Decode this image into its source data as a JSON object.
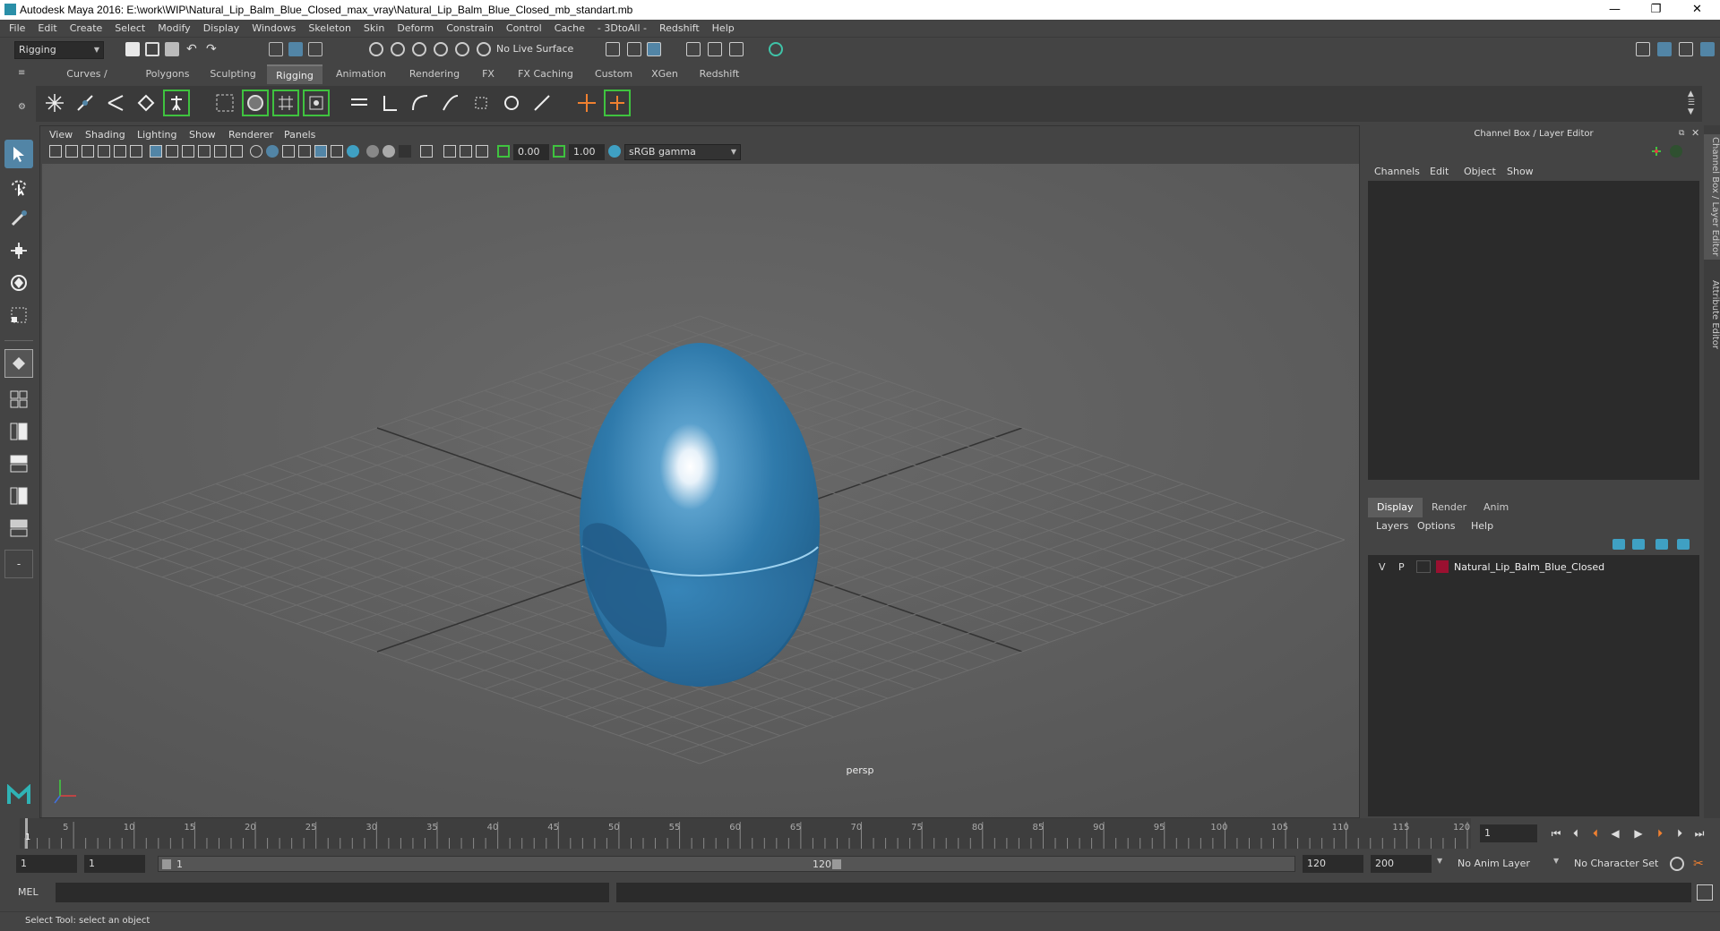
{
  "window": {
    "title": "Autodesk Maya 2016: E:\\work\\WIP\\Natural_Lip_Balm_Blue_Closed_max_vray\\Natural_Lip_Balm_Blue_Closed_mb_standart.mb",
    "minimize": "—",
    "restore": "❐",
    "close": "✕"
  },
  "menubar": [
    "File",
    "Edit",
    "Create",
    "Select",
    "Modify",
    "Display",
    "Windows",
    "Skeleton",
    "Skin",
    "Deform",
    "Constrain",
    "Control",
    "Cache",
    "- 3DtoAll -",
    "Redshift",
    "Help"
  ],
  "statusline": {
    "mode": "Rigging",
    "live_surface": "No Live Surface"
  },
  "shelf": {
    "tabs": [
      "Curves / Surfaces",
      "Polygons",
      "Sculpting",
      "Rigging",
      "Animation",
      "Rendering",
      "FX",
      "FX Caching",
      "Custom",
      "XGen",
      "Redshift"
    ],
    "active_tab": "Rigging"
  },
  "viewport": {
    "menu": [
      "View",
      "Shading",
      "Lighting",
      "Show",
      "Renderer",
      "Panels"
    ],
    "exposure": "0.00",
    "gamma": "1.00",
    "color_space": "sRGB gamma",
    "camera": "persp"
  },
  "channel_box": {
    "title": "Channel Box / Layer Editor",
    "menu": [
      "Channels",
      "Edit",
      "Object",
      "Show"
    ]
  },
  "layer_editor": {
    "tabs": [
      "Display",
      "Render",
      "Anim"
    ],
    "active_tab": "Display",
    "menu": [
      "Layers",
      "Options",
      "Help"
    ],
    "layers": [
      {
        "v": "V",
        "p": "P",
        "name": "Natural_Lip_Balm_Blue_Closed",
        "color": "#9a1030"
      }
    ]
  },
  "side_tabs": [
    "Channel Box / Layer Editor",
    "Attribute Editor"
  ],
  "timeline": {
    "ticks": [
      "5",
      "10",
      "15",
      "20",
      "25",
      "30",
      "35",
      "40",
      "45",
      "50",
      "55",
      "60",
      "65",
      "70",
      "75",
      "80",
      "85",
      "90",
      "95",
      "100",
      "105",
      "110",
      "115",
      "120"
    ],
    "start_marker": "1",
    "current_frame": "1"
  },
  "range": {
    "start": "1",
    "playback_start": "1",
    "slider_start": "1",
    "slider_end": "120",
    "playback_end": "120",
    "end": "200",
    "anim_layer": "No Anim Layer",
    "character_set": "No Character Set"
  },
  "command_line": {
    "label": "MEL"
  },
  "help_line": "Select Tool: select an object",
  "colors": {
    "object_blue": "#2f7aab",
    "accent": "#5285a6"
  }
}
